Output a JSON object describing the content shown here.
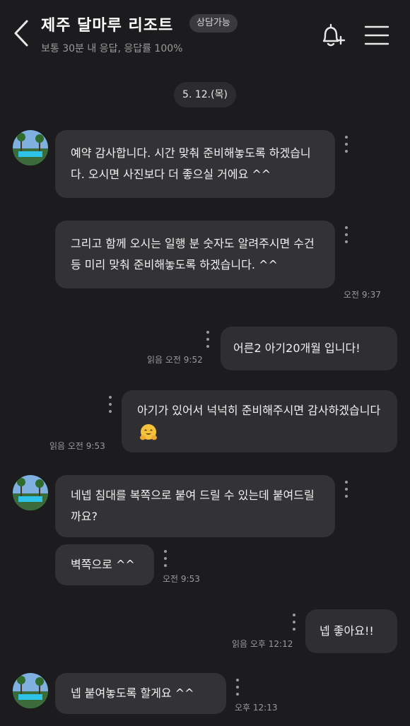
{
  "header": {
    "title": "제주 달마루 리조트",
    "badge": "상담가능",
    "subtitle": "보통 30분 내 응답, 응답률 100%"
  },
  "icons": {
    "back": "chevron-left-icon",
    "notify": "bell-plus-icon",
    "menu": "hamburger-menu-icon",
    "emoji": "hugging-face-emoji"
  },
  "date_divider": "5. 12.(목)",
  "messages": [
    {
      "from": "them",
      "text": "예약 감사합니다. 시간 맞춰 준비해놓도록 하겠습니다. 오시면 사진보다 더 좋으실 거에요 ^^",
      "meta": ""
    },
    {
      "from": "them",
      "text": "그리고 함께 오시는 일행 분 숫자도 알려주시면 수건 등 미리 맞춰 준비해놓도록 하겠습니다. ^^",
      "meta": "오전 9:37"
    },
    {
      "from": "me",
      "text": "어른2 아기20개월 입니다!",
      "meta": "읽음 오전 9:52"
    },
    {
      "from": "me",
      "text": "아기가 있어서 넉넉히 준비해주시면 감사하겠습니다",
      "meta": "읽음 오전 9:53"
    },
    {
      "from": "them",
      "text": "네넵 침대를 복쪽으로 붙여 드릴 수 있는데 붙여드릴까요?",
      "meta": ""
    },
    {
      "from": "them",
      "text": "벽쪽으로 ^^",
      "meta": "오전 9:53"
    },
    {
      "from": "me",
      "text": "넵 좋아요!!",
      "meta": "읽음 오후 12:12"
    },
    {
      "from": "them",
      "text": "넵 붙여놓도록 할게요 ^^",
      "meta": "오후 12:13"
    }
  ]
}
